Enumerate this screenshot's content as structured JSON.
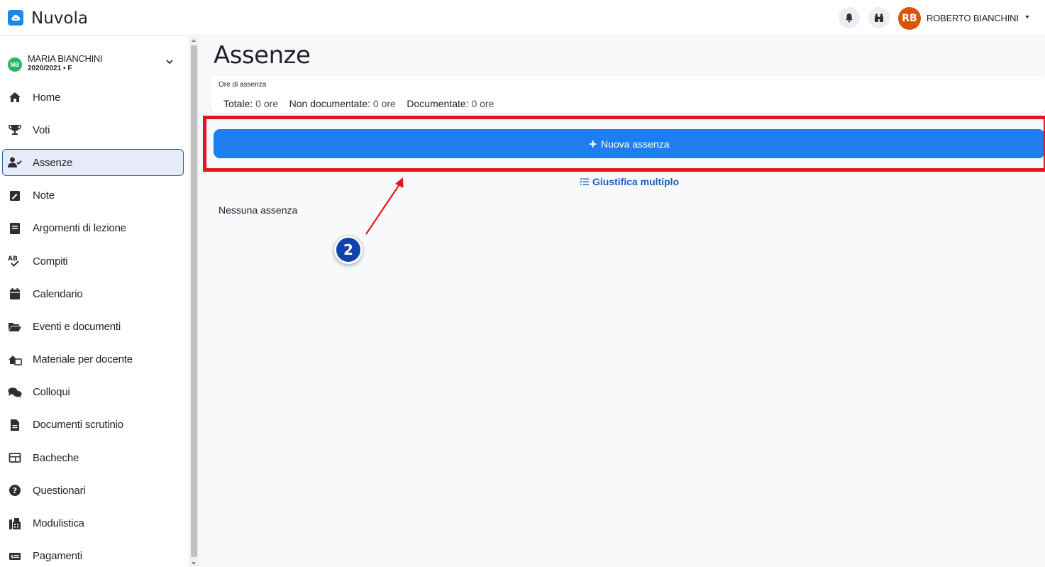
{
  "app": {
    "title": "Nuvola"
  },
  "header": {
    "user_initials": "RB",
    "user_name": "ROBERTO BIANCHINI",
    "icons": [
      "bell-icon",
      "binoculars-icon"
    ]
  },
  "student": {
    "initials": "MB",
    "name": "MARIA BIANCHINI",
    "year": "2020/2021 • F"
  },
  "sidebar": {
    "items": [
      {
        "label": "Home",
        "icon": "home-icon"
      },
      {
        "label": "Voti",
        "icon": "trophy-icon"
      },
      {
        "label": "Assenze",
        "icon": "user-check-icon",
        "active": true
      },
      {
        "label": "Note",
        "icon": "note-icon"
      },
      {
        "label": "Argomenti di lezione",
        "icon": "book-icon"
      },
      {
        "label": "Compiti",
        "icon": "spellcheck-icon"
      },
      {
        "label": "Calendario",
        "icon": "calendar-icon"
      },
      {
        "label": "Eventi e documenti",
        "icon": "folder-open-icon"
      },
      {
        "label": "Materiale per docente",
        "icon": "chalkboard-icon"
      },
      {
        "label": "Colloqui",
        "icon": "comments-icon"
      },
      {
        "label": "Documenti scrutinio",
        "icon": "file-icon"
      },
      {
        "label": "Bacheche",
        "icon": "board-icon"
      },
      {
        "label": "Questionari",
        "icon": "question-circle-icon"
      },
      {
        "label": "Modulistica",
        "icon": "fax-icon"
      },
      {
        "label": "Pagamenti",
        "icon": "money-icon"
      }
    ]
  },
  "main": {
    "title": "Assenze",
    "summary": {
      "title": "Ore di assenza",
      "totale_label": "Totale:",
      "totale_value": "0 ore",
      "nondoc_label": "Non documentate:",
      "nondoc_value": "0 ore",
      "doc_label": "Documentate:",
      "doc_value": "0 ore"
    },
    "new_button": "Nuova assenza",
    "multi_link": "Giustifica multiplo",
    "empty": "Nessuna assenza"
  },
  "annotation": {
    "badge": "2"
  },
  "colors": {
    "accent": "#1e7ef0",
    "highlight": "#e8141b",
    "badge": "#1144a8",
    "avatar": "#d9540a",
    "student_avatar": "#29b36b"
  }
}
